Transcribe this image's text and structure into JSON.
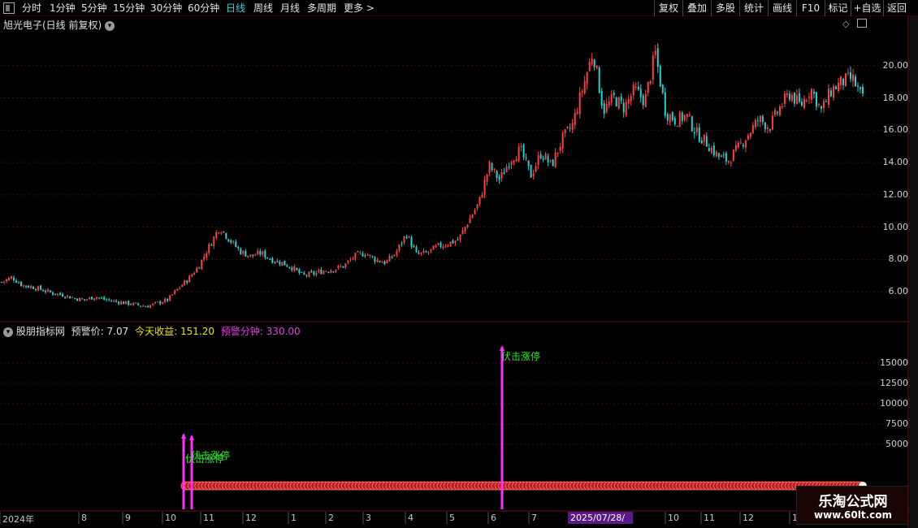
{
  "toolbar": {
    "periods": [
      "分时",
      "1分钟",
      "5分钟",
      "15分钟",
      "30分钟",
      "60分钟",
      "日线",
      "周线",
      "月线",
      "多周期",
      "更多 >"
    ],
    "active_period": "日线",
    "right_buttons": [
      "复权",
      "叠加",
      "多股",
      "统计",
      "画线",
      "F10",
      "标记",
      "+自选",
      "返回"
    ]
  },
  "main_chart": {
    "title": "旭光电子(日线 前复权)",
    "collapse_icon": "chevron-down-icon"
  },
  "indicator": {
    "name": "股朋指标网",
    "alert_price_label": "预警价:",
    "alert_price_value": "7.07",
    "today_gain_label": "今天收益:",
    "today_gain_value": "151.20",
    "alert_minutes_label": "预警分钟:",
    "alert_minutes_value": "330.00",
    "signal_label": "伏击涨停",
    "colors": {
      "alert_price": "#e0e0e0",
      "today_gain": "#e6e600",
      "alert_minutes": "#e040e0",
      "signal": "#2ee62e",
      "spike": "#ff2fff"
    }
  },
  "date_axis": {
    "labels": [
      "2024年",
      "8",
      "9",
      "10",
      "11",
      "12",
      "1",
      "2",
      "3",
      "4",
      "5",
      "6",
      "7",
      "2025/07/28/—",
      "10",
      "11",
      "12",
      "1"
    ],
    "cursor_label": "2025/07/28/—"
  },
  "watermark": {
    "line1": "乐淘公式网",
    "line2": "www.60lt.com"
  },
  "colors": {
    "up": "#ff4040",
    "down": "#2ad0d0",
    "grid": "#4a0a0a",
    "axis_border": "#6a1010"
  },
  "chart_data": [
    {
      "type": "candlestick",
      "title": "旭光电子(日线 前复权)",
      "y_ticks": [
        6.0,
        8.0,
        10.0,
        12.0,
        14.0,
        16.0,
        18.0,
        20.0
      ],
      "ylim": [
        4.2,
        22.2
      ],
      "x_range": [
        "2024-07",
        "2026-01"
      ],
      "closing_series": [
        6.6,
        6.9,
        6.4,
        6.3,
        6.1,
        5.9,
        5.8,
        5.6,
        5.5,
        5.7,
        5.5,
        5.4,
        5.3,
        5.2,
        5.1,
        5.3,
        5.5,
        6.2,
        6.8,
        7.6,
        8.8,
        10.0,
        9.2,
        8.5,
        8.2,
        8.4,
        8.0,
        7.8,
        7.5,
        7.0,
        7.1,
        7.3,
        7.4,
        7.6,
        8.2,
        8.4,
        8.0,
        7.8,
        8.4,
        9.6,
        8.3,
        8.4,
        8.8,
        9.0,
        9.2,
        10.4,
        11.5,
        13.8,
        12.9,
        14.2,
        14.8,
        13.2,
        14.6,
        13.8,
        15.4,
        16.3,
        18.6,
        20.9,
        17.2,
        18.0,
        17.4,
        18.5,
        17.8,
        20.8,
        17.1,
        16.6,
        16.9,
        15.8,
        15.2,
        14.4,
        14.1,
        14.9,
        15.8,
        16.7,
        16.2,
        17.4,
        18.3,
        17.5,
        18.6,
        17.2,
        18.5,
        19.0,
        19.2,
        17.9
      ],
      "grid": true
    },
    {
      "type": "bar",
      "title": "股朋指标网",
      "y_ticks": [
        5000,
        7500,
        10000,
        12500,
        15000
      ],
      "ylim": [
        0,
        19000
      ],
      "series": [
        {
          "name": "伏击涨停",
          "values": [
            6200,
            6000,
            19000
          ]
        }
      ],
      "categories": [
        "2024-10",
        "2024-10",
        "2025-06"
      ]
    }
  ]
}
